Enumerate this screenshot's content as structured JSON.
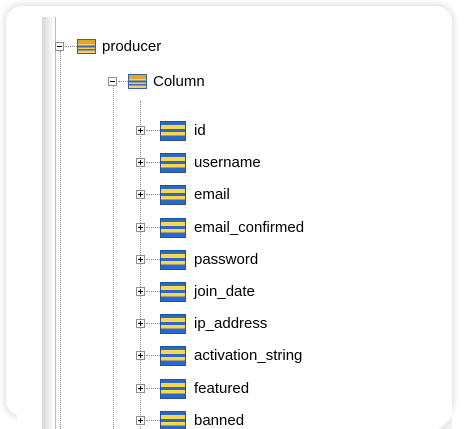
{
  "tree": {
    "root": {
      "label": "producer",
      "icon": "table-icon",
      "expanded": true
    },
    "group": {
      "label": "Column",
      "icon": "column-group-icon",
      "expanded": true
    },
    "columns": [
      {
        "label": "id"
      },
      {
        "label": "username"
      },
      {
        "label": "email"
      },
      {
        "label": "email_confirmed"
      },
      {
        "label": "password"
      },
      {
        "label": "join_date"
      },
      {
        "label": "ip_address"
      },
      {
        "label": "activation_string"
      },
      {
        "label": "featured"
      },
      {
        "label": "banned"
      }
    ]
  }
}
